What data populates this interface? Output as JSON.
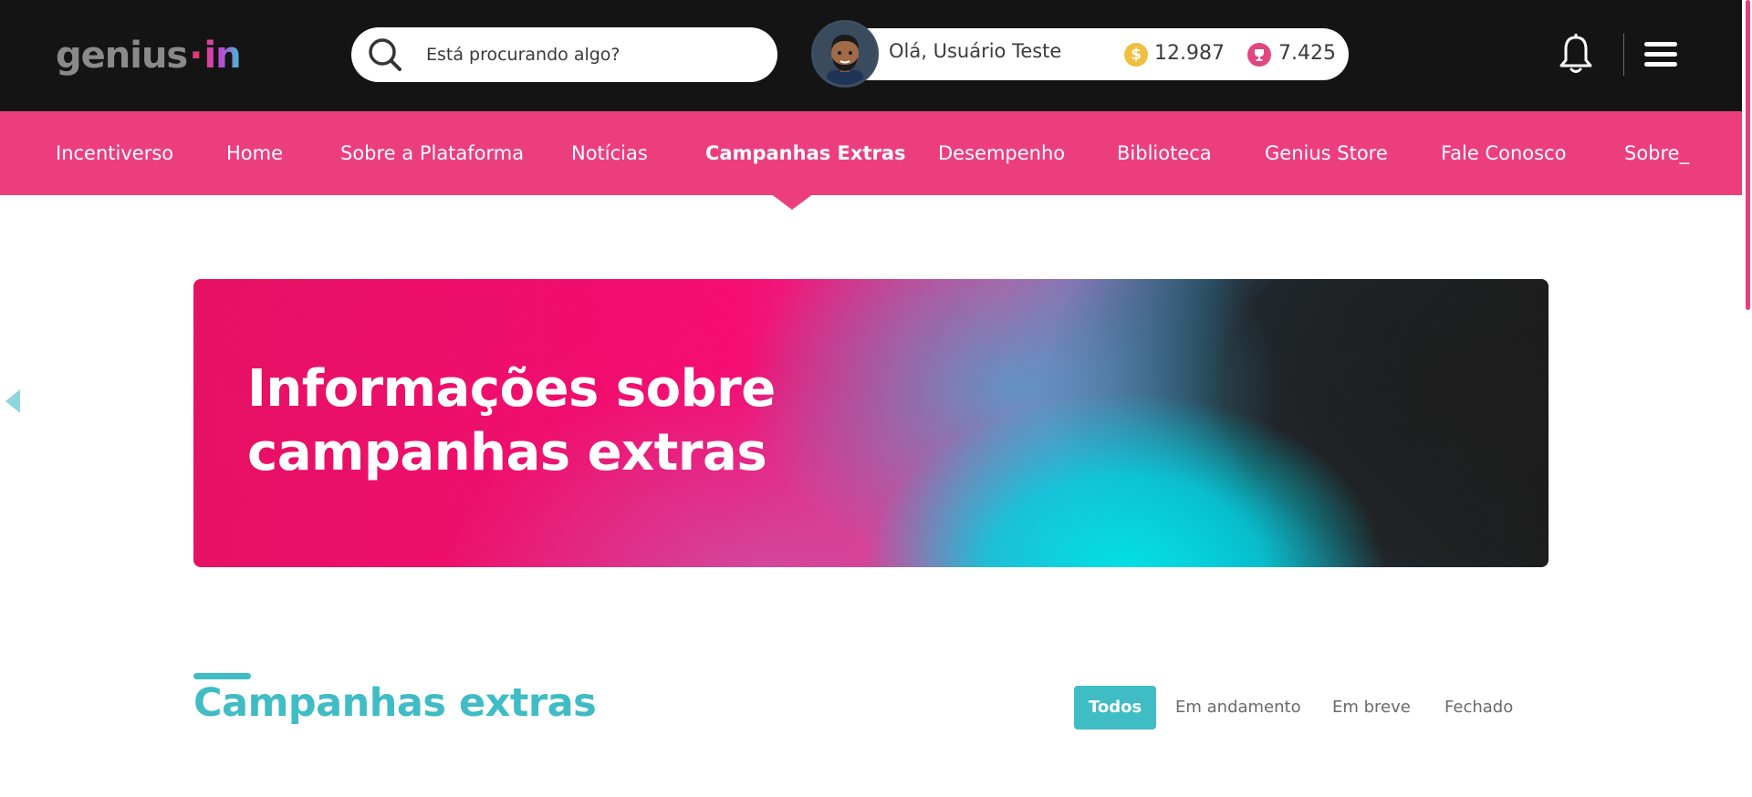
{
  "header": {
    "logo_text": "genius",
    "logo_dot": "·",
    "logo_in": "in",
    "search_placeholder": "Está procurando algo?",
    "greeting": "Olá, Usuário Teste",
    "coin_symbol": "$",
    "coins": "12.987",
    "trophies": "7.425"
  },
  "nav": {
    "items": [
      {
        "label": "Incentiverso"
      },
      {
        "label": "Home"
      },
      {
        "label": "Sobre a Plataforma"
      },
      {
        "label": "Notícias"
      },
      {
        "label": "Campanhas Extras",
        "active": true
      },
      {
        "label": "Desempenho"
      },
      {
        "label": "Biblioteca"
      },
      {
        "label": "Genius Store"
      },
      {
        "label": "Fale Conosco"
      },
      {
        "label": "Sobre_"
      }
    ]
  },
  "banner": {
    "title": "Informações sobre campanhas extras"
  },
  "section": {
    "title": "Campanhas extras",
    "filters": [
      {
        "label": "Todos",
        "active": true
      },
      {
        "label": "Em andamento"
      },
      {
        "label": "Em breve"
      },
      {
        "label": "Fechado"
      }
    ]
  },
  "colors": {
    "header_bg": "#141414",
    "nav_bg": "#ec3e7d",
    "accent_teal": "#3fbcc4",
    "coin": "#f2be3f",
    "trophy": "#e2467f"
  }
}
